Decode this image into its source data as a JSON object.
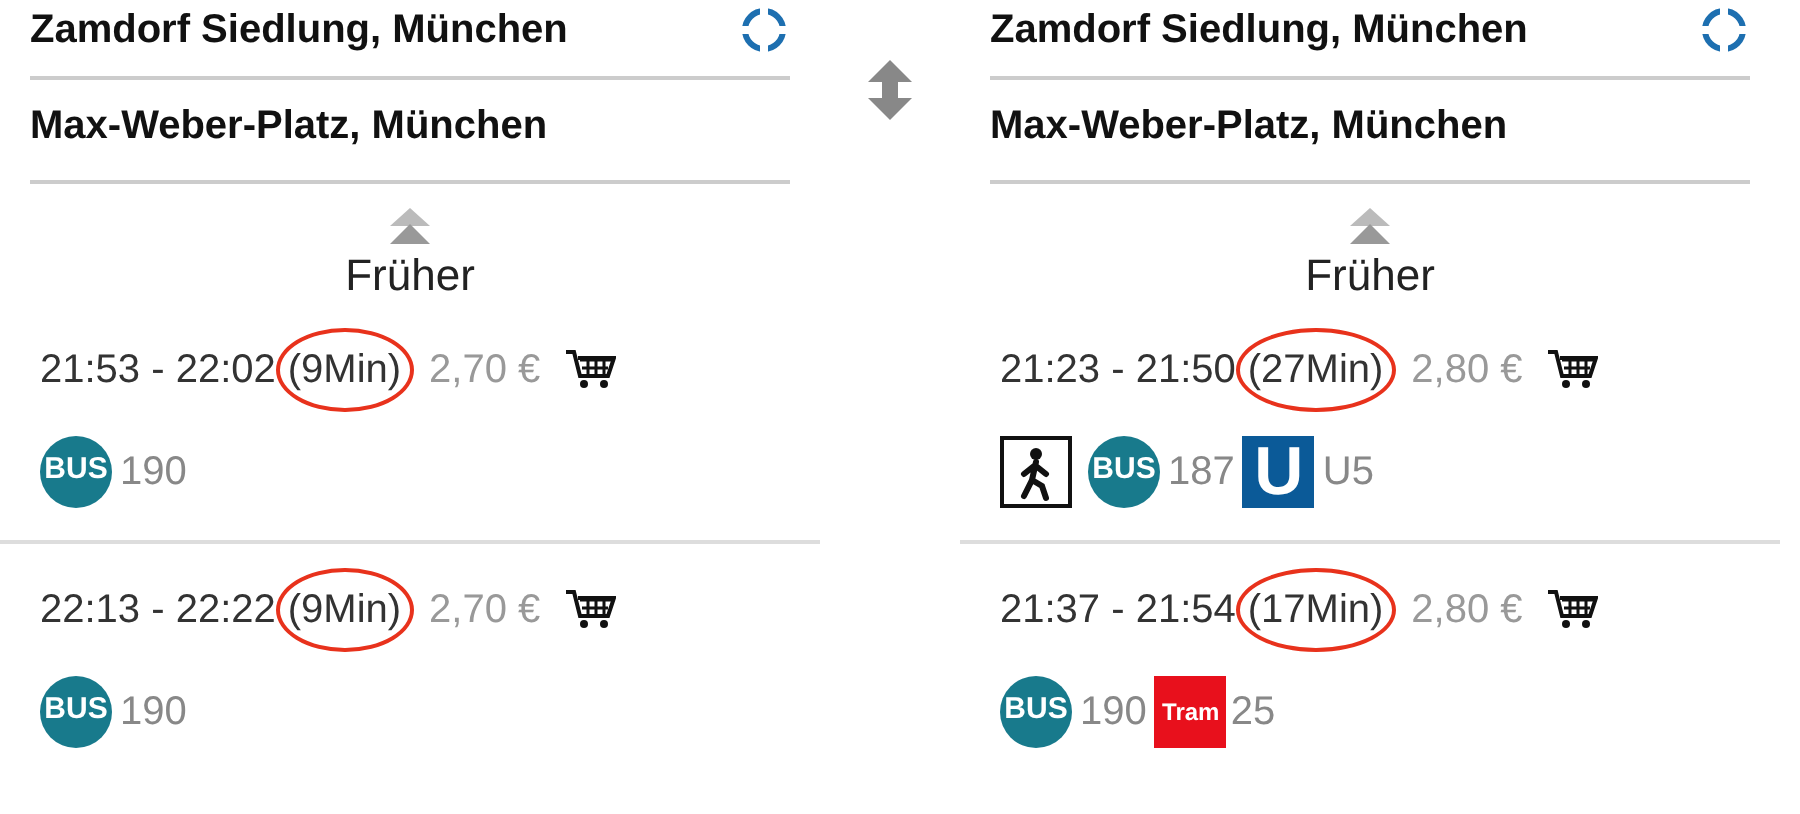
{
  "panels": [
    {
      "from": "Zamdorf Siedlung, München",
      "to": "Max-Weber-Platz, München",
      "earlier": "Früher",
      "connections": [
        {
          "times": "21:53 - 22:02",
          "duration": "(9Min)",
          "circled": true,
          "price": "2,70 €",
          "legs": [
            {
              "kind": "bus",
              "badge": "BUS",
              "line": "190"
            }
          ]
        },
        {
          "times": "22:13 - 22:22",
          "duration": "(9Min)",
          "circled": true,
          "price": "2,70 €",
          "legs": [
            {
              "kind": "bus",
              "badge": "BUS",
              "line": "190"
            }
          ]
        }
      ]
    },
    {
      "from": "Zamdorf Siedlung, München",
      "to": "Max-Weber-Platz, München",
      "earlier": "Früher",
      "connections": [
        {
          "times": "21:23 - 21:50",
          "duration": "(27Min)",
          "circled": true,
          "price": "2,80 €",
          "legs": [
            {
              "kind": "walk"
            },
            {
              "kind": "bus",
              "badge": "BUS",
              "line": "187"
            },
            {
              "kind": "ubahn",
              "badge": "U",
              "line": "U5"
            }
          ]
        },
        {
          "times": "21:37 - 21:54",
          "duration": "(17Min)",
          "circled": true,
          "price": "2,80 €",
          "legs": [
            {
              "kind": "bus",
              "badge": "BUS",
              "line": "190"
            },
            {
              "kind": "tram",
              "badge": "Tram",
              "line": "25"
            }
          ]
        }
      ]
    }
  ]
}
